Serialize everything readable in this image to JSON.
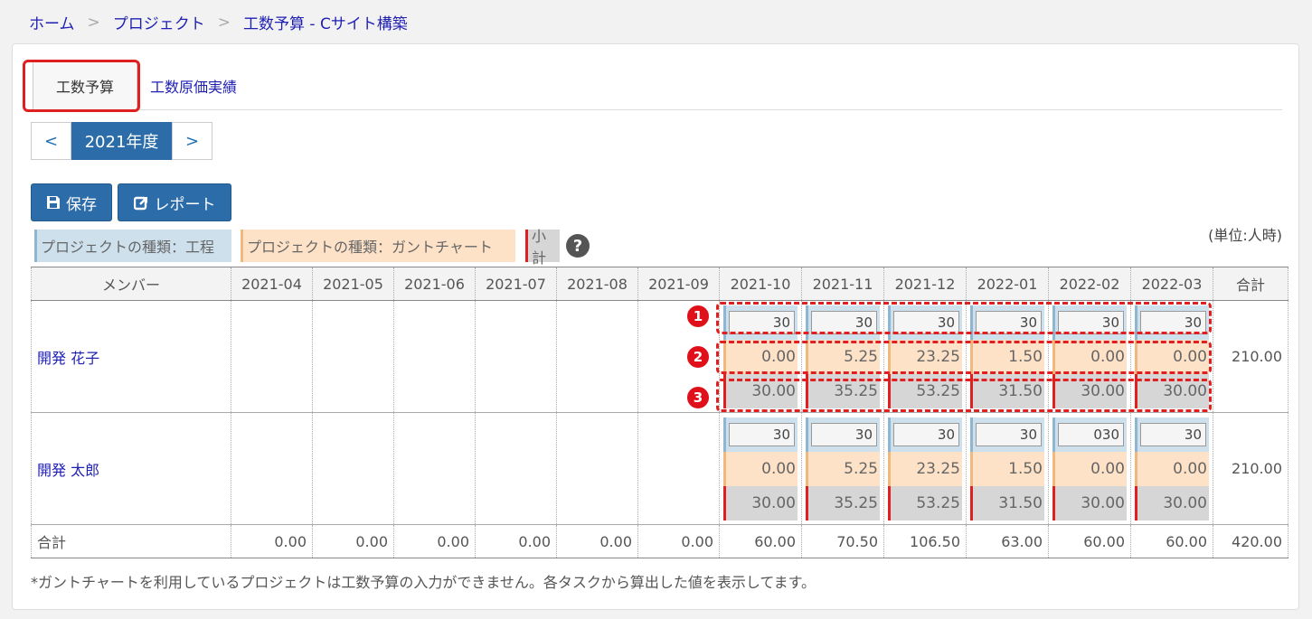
{
  "breadcrumb": [
    "ホーム",
    "プロジェクト",
    "工数予算 - Cサイト構築"
  ],
  "tabs": {
    "active": "工数予算",
    "other": "工数原価実績"
  },
  "year_nav": {
    "prev": "<",
    "year": "2021年度",
    "next": ">"
  },
  "buttons": {
    "save": "保存",
    "report": "レポート"
  },
  "legend": {
    "process": "プロジェクトの種類：工程",
    "gantt": "プロジェクトの種類：ガントチャート",
    "subtotal": "小計",
    "help": "?"
  },
  "unit": "(単位:人時)",
  "table": {
    "header_member": "メンバー",
    "months": [
      "2021-04",
      "2021-05",
      "2021-06",
      "2021-07",
      "2021-08",
      "2021-09",
      "2021-10",
      "2021-11",
      "2021-12",
      "2022-01",
      "2022-02",
      "2022-03"
    ],
    "header_total": "合計",
    "members": [
      {
        "name": "開発 花子",
        "inputs": [
          "30",
          "30",
          "30",
          "30",
          "30",
          "30"
        ],
        "gantt": [
          "0.00",
          "5.25",
          "23.25",
          "1.50",
          "0.00",
          "0.00"
        ],
        "subtotal": [
          "30.00",
          "35.25",
          "53.25",
          "31.50",
          "30.00",
          "30.00"
        ],
        "total": "210.00"
      },
      {
        "name": "開発 太郎",
        "inputs": [
          "30",
          "30",
          "30",
          "30",
          "030",
          "30"
        ],
        "gantt": [
          "0.00",
          "5.25",
          "23.25",
          "1.50",
          "0.00",
          "0.00"
        ],
        "subtotal": [
          "30.00",
          "35.25",
          "53.25",
          "31.50",
          "30.00",
          "30.00"
        ],
        "total": "210.00"
      }
    ],
    "total_label": "合計",
    "totals": [
      "0.00",
      "0.00",
      "0.00",
      "0.00",
      "0.00",
      "0.00",
      "60.00",
      "70.50",
      "106.50",
      "63.00",
      "60.00",
      "60.00"
    ],
    "grand_total": "420.00"
  },
  "markers": [
    "1",
    "2",
    "3"
  ],
  "footnote": "*ガントチャートを利用しているプロジェクトは工数予算の入力ができません。各タスクから算出した値を表示してます。",
  "colors": {
    "accent": "#2c6ca8",
    "link": "#1f1fb4",
    "highlight": "#e02020",
    "process_bg": "#cde0ec",
    "gantt_bg": "#fde2c7",
    "subtotal_bg": "#d6d6d6"
  }
}
